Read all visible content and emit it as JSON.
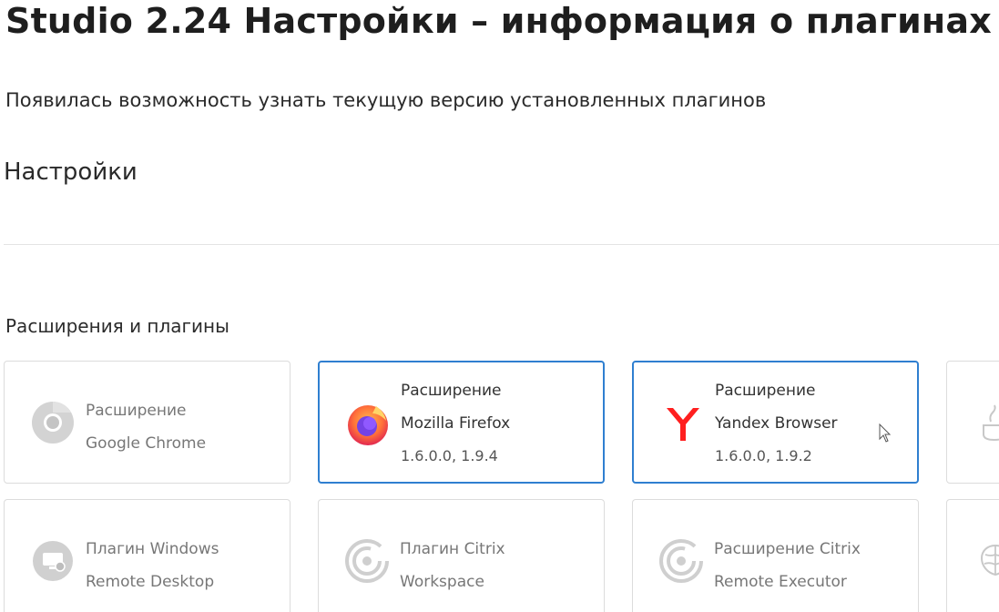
{
  "header": {
    "title": "Studio 2.24 Настройки – информация о плагинах",
    "subtitle": "Появилась возможность узнать текущую версию установленных плагинов"
  },
  "settings": {
    "title": "Настройки",
    "section_title": "Расширения и плагины"
  },
  "cards": [
    {
      "line1": "Расширение",
      "line2": "Google Chrome",
      "version": "",
      "icon": "chrome-icon",
      "active": false
    },
    {
      "line1": "Расширение",
      "line2": "Mozilla Firefox",
      "version": "1.6.0.0, 1.9.4",
      "icon": "firefox-icon",
      "active": true
    },
    {
      "line1": "Расширение",
      "line2": "Yandex Browser",
      "version": "1.6.0.0, 1.9.2",
      "icon": "yandex-icon",
      "active": true
    },
    {
      "line1": "",
      "line2": "",
      "version": "",
      "icon": "java-icon",
      "active": false
    },
    {
      "line1": "Плагин Windows",
      "line2": "Remote Desktop",
      "version": "",
      "icon": "remote-desktop-icon",
      "active": false
    },
    {
      "line1": "Плагин Citrix",
      "line2": "Workspace",
      "version": "",
      "icon": "citrix-icon",
      "active": false
    },
    {
      "line1": "Расширение Citrix",
      "line2": "Remote Executor",
      "version": "",
      "icon": "citrix-icon",
      "active": false
    },
    {
      "line1": "",
      "line2": "",
      "version": "",
      "icon": "brain-icon",
      "active": false
    }
  ],
  "colors": {
    "active_border": "#2f7fd0",
    "firefox": "#ff7139",
    "yandex": "#ff1f1f",
    "disabled_icon": "#c8c8c8"
  }
}
